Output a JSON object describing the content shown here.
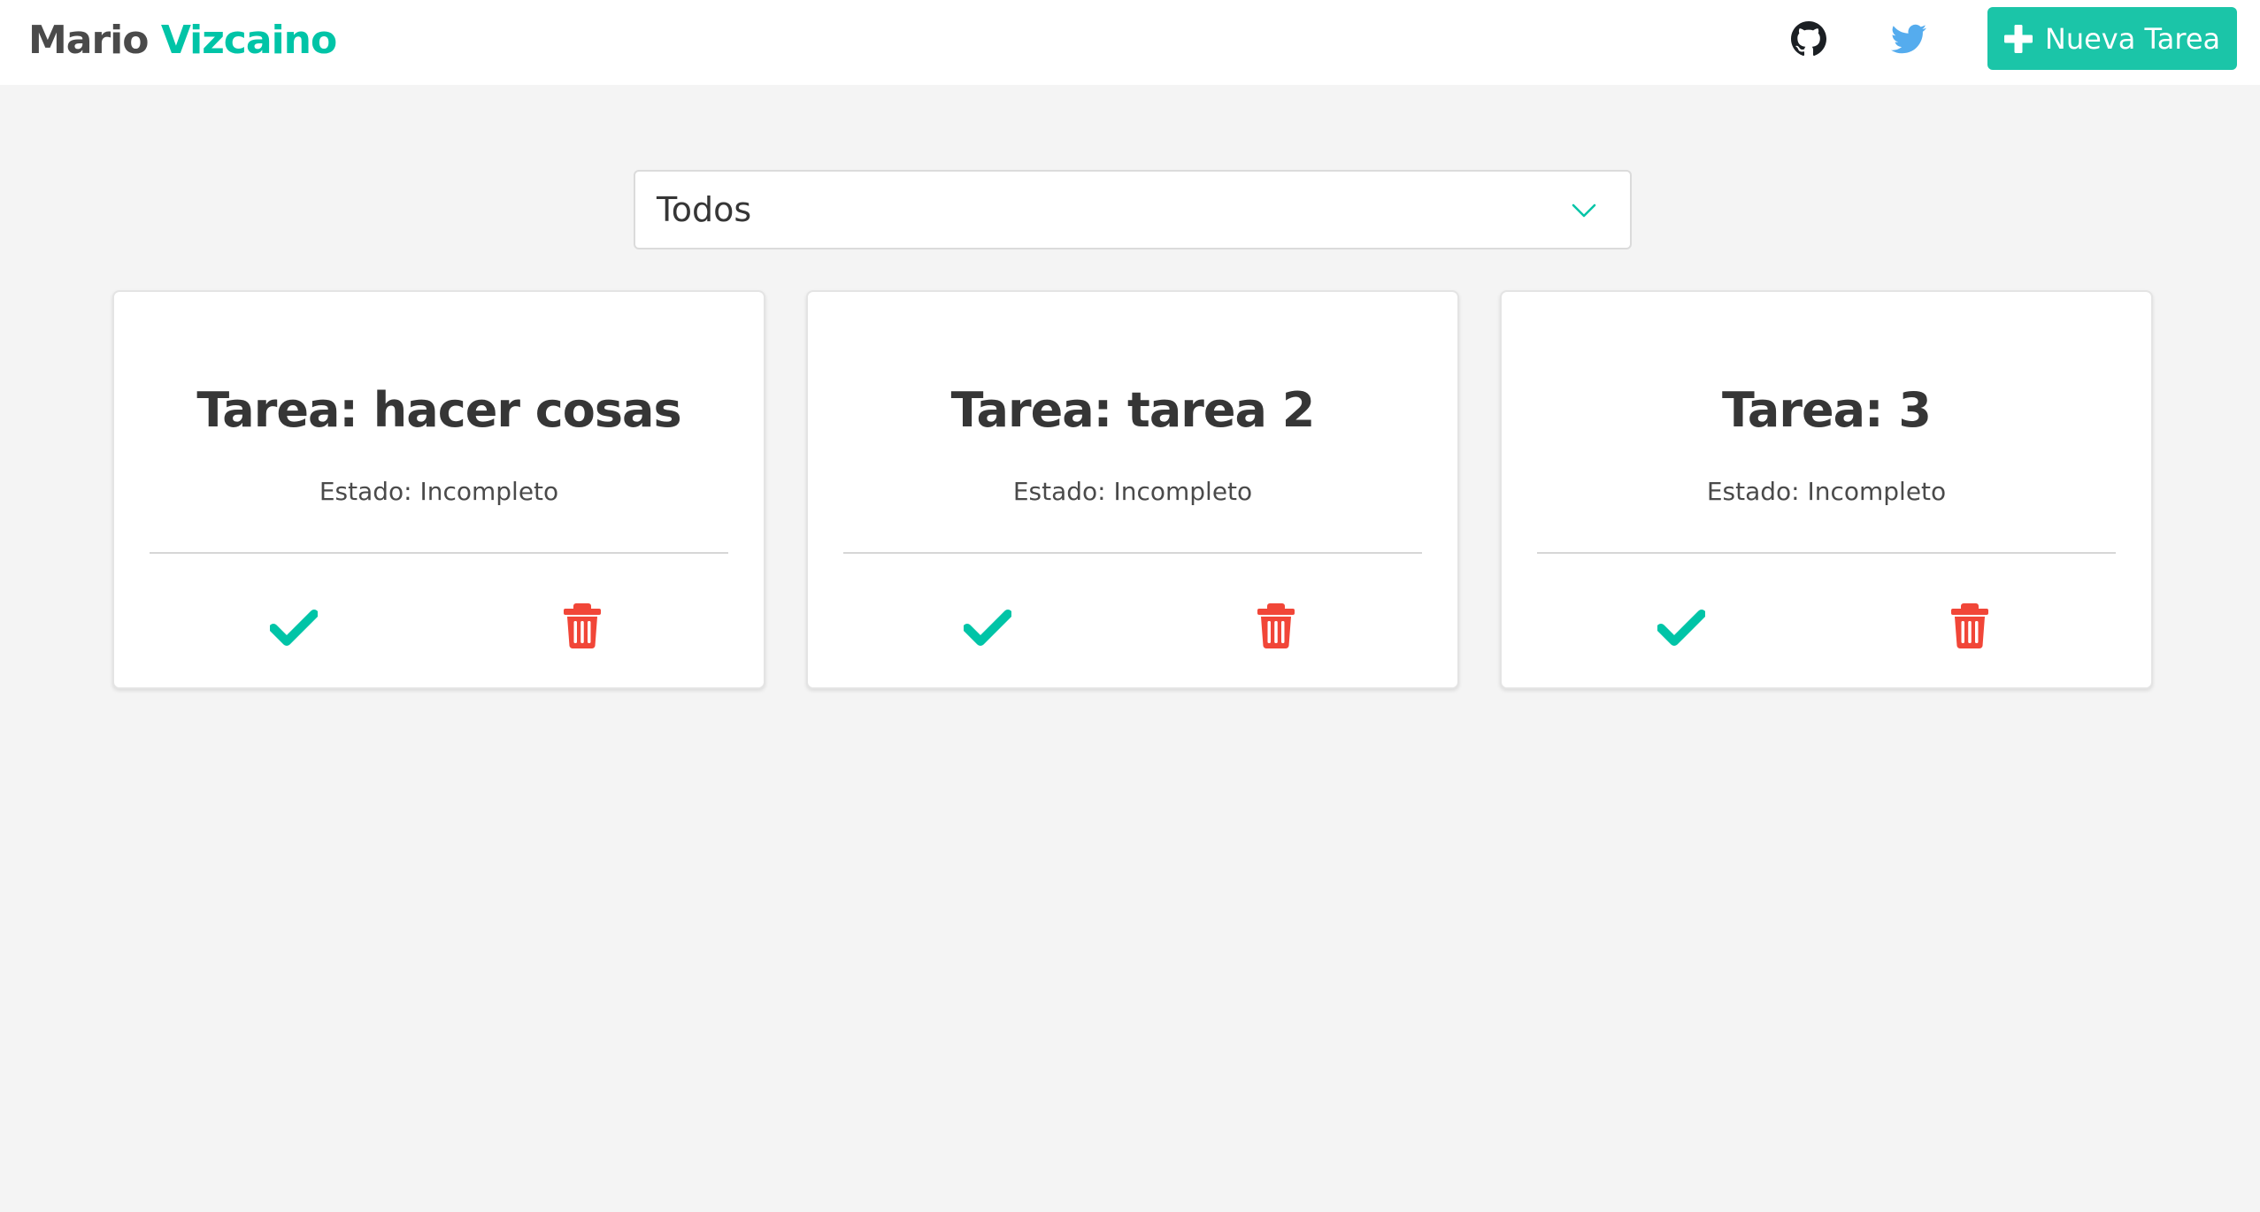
{
  "header": {
    "brand_first": "Mario",
    "brand_last": "Vizcaino",
    "github_icon": "github-icon",
    "twitter_icon": "twitter-icon",
    "new_task_label": "Nueva Tarea"
  },
  "filter": {
    "selected": "Todos"
  },
  "tasks": [
    {
      "title": "Tarea: hacer cosas",
      "status": "Estado: Incompleto"
    },
    {
      "title": "Tarea: tarea 2",
      "status": "Estado: Incompleto"
    },
    {
      "title": "Tarea: 3",
      "status": "Estado: Incompleto"
    }
  ],
  "colors": {
    "accent": "#00c4a7",
    "button": "#1bc5a8",
    "danger": "#f14638",
    "twitter": "#55acee",
    "background": "#f4f4f4"
  }
}
